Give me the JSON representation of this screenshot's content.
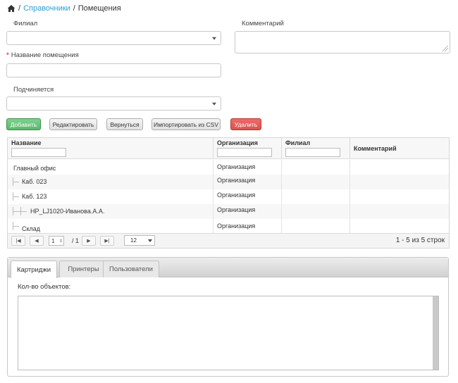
{
  "breadcrumb": {
    "link": "Справочники",
    "sep": "/",
    "current": "Помещения"
  },
  "form": {
    "filial_label": "Филиал",
    "comment_label": "Комментарий",
    "name_label": "Название помещения",
    "required_mark": "*",
    "parent_label": "Подчиняется"
  },
  "toolbar": {
    "add": "Добавить",
    "edit": "Редактировать",
    "back": "Вернуться",
    "import": "Импортировать из CSV",
    "delete": "Удалить"
  },
  "grid": {
    "columns": [
      "Название",
      "Организация",
      "Филиал",
      "Комментарий"
    ],
    "rows": [
      {
        "name": "Главный офис",
        "org": "Организация",
        "filial": "",
        "comment": ""
      },
      {
        "name": "Каб. 023",
        "org": "Организация",
        "filial": "",
        "comment": ""
      },
      {
        "name": "Каб. 123",
        "org": "Организация",
        "filial": "",
        "comment": ""
      },
      {
        "name": "HP_LJ1020-Иванова.А.А.",
        "org": "Организация",
        "filial": "",
        "comment": ""
      },
      {
        "name": "Склад",
        "org": "Организация",
        "filial": "",
        "comment": ""
      }
    ],
    "pager": {
      "page": "1",
      "of": "/ 1",
      "page_size": "12",
      "summary": "1 - 5 из 5 строк"
    }
  },
  "tabs": [
    {
      "label": "Картриджи",
      "active": true
    },
    {
      "label": "Принтеры",
      "active": false
    },
    {
      "label": "Пользователи",
      "active": false
    }
  ],
  "count_label": "Кол-во объектов:",
  "colors": {
    "link": "#2a9fd6",
    "add": "#5cb86c",
    "delete": "#d9534f"
  },
  "icons": [
    "home-icon",
    "first-page-icon",
    "prev-page-icon",
    "next-page-icon",
    "last-page-icon"
  ]
}
